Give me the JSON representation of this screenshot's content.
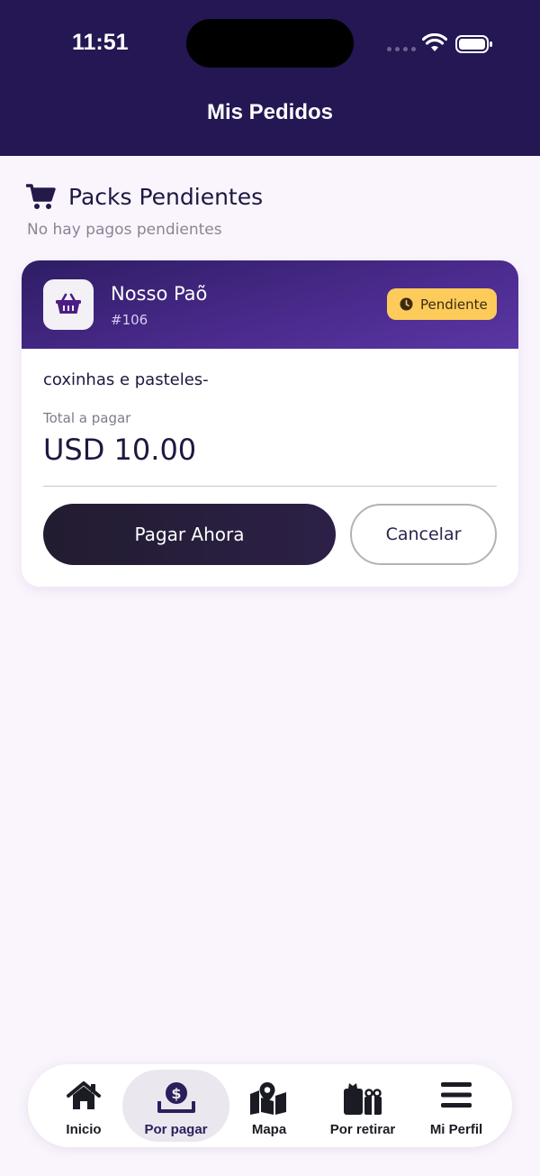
{
  "status_bar": {
    "time": "11:51"
  },
  "header": {
    "title": "Mis Pedidos"
  },
  "section": {
    "icon": "cart-icon",
    "title": "Packs Pendientes",
    "subtitle": "No hay pagos pendientes"
  },
  "order": {
    "store_icon": "basket-icon",
    "store_name": "Nosso Paõ",
    "order_number": "#106",
    "status": "Pendiente",
    "status_icon": "clock-icon",
    "description": "coxinhas e pasteles-",
    "total_label": "Total a pagar",
    "total_value": "USD 10.00",
    "pay_label": "Pagar Ahora",
    "cancel_label": "Cancelar"
  },
  "colors": {
    "header": "#241753",
    "accent": "#4b2b8e",
    "badge": "#fdcb5a",
    "background": "#faf5fd"
  },
  "bottom_nav": {
    "active": "Por pagar",
    "items": [
      {
        "label": "Inicio",
        "icon": "home-icon"
      },
      {
        "label": "Por pagar",
        "icon": "dollar-tray-icon"
      },
      {
        "label": "Mapa",
        "icon": "map-icon"
      },
      {
        "label": "Por retirar",
        "icon": "gift-icon"
      },
      {
        "label": "Mi Perfil",
        "icon": "menu-icon"
      }
    ]
  }
}
